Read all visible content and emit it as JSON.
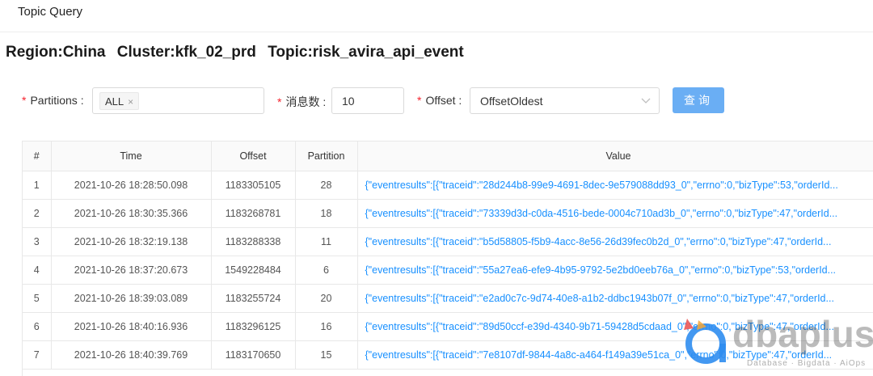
{
  "app": {
    "title": "Topic Query"
  },
  "heading": {
    "region": "Region:China",
    "cluster": "Cluster:kfk_02_prd",
    "topic": "Topic:risk_avira_api_event"
  },
  "form": {
    "required_mark": "*",
    "partitions_label": "Partitions :",
    "partitions_tag": "ALL",
    "partitions_tag_remove": "×",
    "count_label": "消息数 :",
    "count_value": "10",
    "offset_label": "Offset :",
    "offset_value": "OffsetOldest",
    "offset_icon": "chevron-down-icon",
    "query_button": "查询"
  },
  "colors": {
    "primary_button": "#6aaef4",
    "link": "#1890ff",
    "required": "#f5222d"
  },
  "table": {
    "columns": [
      "#",
      "Time",
      "Offset",
      "Partition",
      "Value"
    ],
    "rows": [
      {
        "n": "1",
        "time": "2021-10-26 18:28:50.098",
        "offset": "1183305105",
        "partition": "28",
        "value": "{\"eventresults\":[{\"traceid\":\"28d244b8-99e9-4691-8dec-9e579088dd93_0\",\"errno\":0,\"bizType\":53,\"orderId..."
      },
      {
        "n": "2",
        "time": "2021-10-26 18:30:35.366",
        "offset": "1183268781",
        "partition": "18",
        "value": "{\"eventresults\":[{\"traceid\":\"73339d3d-c0da-4516-bede-0004c710ad3b_0\",\"errno\":0,\"bizType\":47,\"orderId..."
      },
      {
        "n": "3",
        "time": "2021-10-26 18:32:19.138",
        "offset": "1183288338",
        "partition": "11",
        "value": "{\"eventresults\":[{\"traceid\":\"b5d58805-f5b9-4acc-8e56-26d39fec0b2d_0\",\"errno\":0,\"bizType\":47,\"orderId..."
      },
      {
        "n": "4",
        "time": "2021-10-26 18:37:20.673",
        "offset": "1549228484",
        "partition": "6",
        "value": "{\"eventresults\":[{\"traceid\":\"55a27ea6-efe9-4b95-9792-5e2bd0eeb76a_0\",\"errno\":0,\"bizType\":53,\"orderId..."
      },
      {
        "n": "5",
        "time": "2021-10-26 18:39:03.089",
        "offset": "1183255724",
        "partition": "20",
        "value": "{\"eventresults\":[{\"traceid\":\"e2ad0c7c-9d74-40e8-a1b2-ddbc1943b07f_0\",\"errno\":0,\"bizType\":47,\"orderId..."
      },
      {
        "n": "6",
        "time": "2021-10-26 18:40:16.936",
        "offset": "1183296125",
        "partition": "16",
        "value": "{\"eventresults\":[{\"traceid\":\"89d50ccf-e39d-4340-9b71-59428d5cdaad_0\",\"errno\":0,\"bizType\":47,\"orderId..."
      },
      {
        "n": "7",
        "time": "2021-10-26 18:40:39.769",
        "offset": "1183170650",
        "partition": "15",
        "value": "{\"eventresults\":[{\"traceid\":\"7e8107df-9844-4a8c-a464-f149a39e51ca_0\",\"errno\":0,\"bizType\":47,\"orderId..."
      }
    ]
  },
  "watermark": {
    "brand": "dbaplus",
    "tagline": "Database · Bigdata · AiOps"
  }
}
